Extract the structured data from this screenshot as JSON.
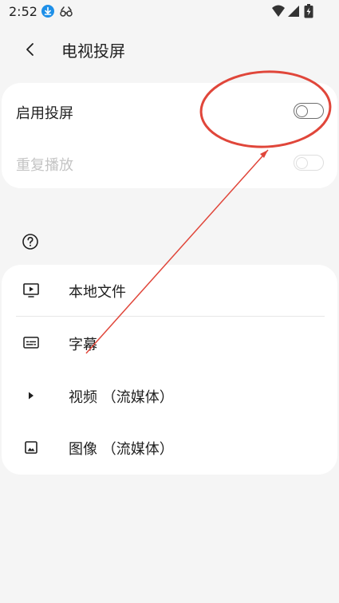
{
  "status_bar": {
    "time": "2:52",
    "icons": [
      "download-icon",
      "glasses-icon",
      "wifi-icon",
      "signal-icon",
      "battery-icon"
    ]
  },
  "header": {
    "title": "电视投屏",
    "back_icon": "back-arrow-icon"
  },
  "settings": {
    "enable_cast": {
      "label": "启用投屏",
      "enabled": false
    },
    "repeat_play": {
      "label": "重复播放",
      "enabled": false,
      "disabled": true
    }
  },
  "help": {
    "icon": "help-icon"
  },
  "media_menu": {
    "items": [
      {
        "label": "本地文件",
        "icon": "play-screen-icon"
      },
      {
        "label": "字幕",
        "icon": "subtitles-icon"
      },
      {
        "label": "视频 （流媒体）",
        "icon": "play-arrow-icon"
      },
      {
        "label": "图像 （流媒体）",
        "icon": "image-icon"
      }
    ]
  },
  "colors": {
    "background": "#f5f5f5",
    "card": "#ffffff",
    "disabled_text": "#c4c4c4",
    "annotation": "#e0463a",
    "download_badge": "#1d8fe8"
  }
}
